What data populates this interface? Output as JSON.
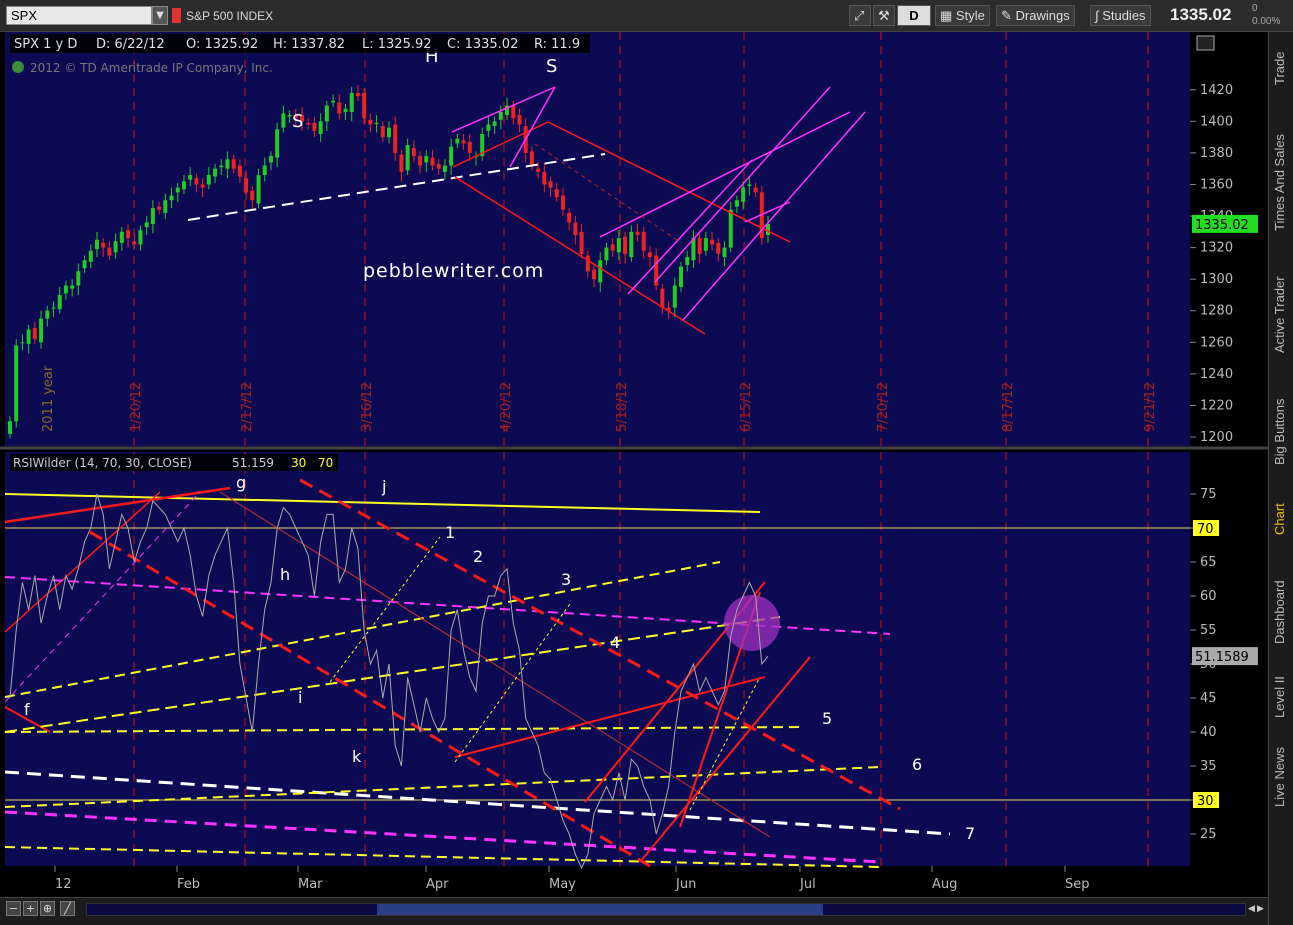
{
  "toolbar": {
    "symbol": "SPX",
    "description": "S&P 500 INDEX",
    "period_button": "D",
    "style_label": "Style",
    "drawings_label": "Drawings",
    "studies_label": "Studies",
    "last_price": "1335.02",
    "change_top": "0",
    "change_bottom": "0.00%"
  },
  "price_header": {
    "symbol_period": "SPX 1 y D",
    "date": "D: 6/22/12",
    "open": "O: 1325.92",
    "high": "H: 1337.82",
    "low": "L: 1325.92",
    "close": "C: 1335.02",
    "range": "R: 11.9",
    "copyright": "2012 © TD Ameritrade IP Company, Inc."
  },
  "rsi_header": {
    "study": "RSIWilder (14, 70, 30, CLOSE)",
    "value": "51.159",
    "ob": "30",
    "os": "70"
  },
  "sidebar": {
    "tabs": [
      "Trade",
      "Times And Sales",
      "Active Trader",
      "Big Buttons",
      "Chart",
      "Dashboard",
      "Level II",
      "Live News"
    ],
    "active": "Chart"
  },
  "colors": {
    "background": "#0c0a52",
    "grid_red": "#cc1010",
    "up": "#22cc22",
    "down": "#ee2222",
    "red_line": "#ff1a1a",
    "magenta": "#ff33ff",
    "yellow": "#ffff22",
    "white": "#ffffff"
  },
  "chart_data": [
    {
      "type": "candlestick",
      "title": "SPX 1 y D",
      "ylim": [
        1200,
        1430
      ],
      "y_ticks": [
        1200,
        1220,
        1240,
        1260,
        1280,
        1300,
        1320,
        1340,
        1360,
        1380,
        1400,
        1420
      ],
      "last_value_label": "1335.02",
      "watermark": "pebblewriter.com",
      "period_label": "2011 year",
      "date_markers": [
        "1/20/12",
        "2/17/12",
        "3/16/12",
        "4/20/12",
        "5/18/12",
        "6/15/12",
        "7/20/12",
        "8/17/12",
        "9/21/12"
      ],
      "annotations": [
        "S",
        "H",
        "S"
      ],
      "close_series": [
        1210,
        1258,
        1260,
        1268,
        1262,
        1275,
        1280,
        1282,
        1290,
        1296,
        1296,
        1305,
        1312,
        1318,
        1325,
        1320,
        1315,
        1324,
        1330,
        1326,
        1322,
        1331,
        1336,
        1345,
        1344,
        1350,
        1353,
        1358,
        1362,
        1366,
        1360,
        1358,
        1366,
        1370,
        1372,
        1376,
        1370,
        1365,
        1355,
        1350,
        1366,
        1372,
        1378,
        1395,
        1405,
        1404,
        1402,
        1400,
        1398,
        1394,
        1400,
        1410,
        1413,
        1405,
        1408,
        1418,
        1416,
        1402,
        1398,
        1399,
        1390,
        1396,
        1380,
        1368,
        1385,
        1378,
        1372,
        1378,
        1372,
        1370,
        1372,
        1384,
        1389,
        1386,
        1380,
        1378,
        1392,
        1398,
        1400,
        1406,
        1410,
        1402,
        1398,
        1380,
        1372,
        1368,
        1360,
        1358,
        1352,
        1344,
        1336,
        1328,
        1316,
        1305,
        1300,
        1312,
        1320,
        1318,
        1326,
        1316,
        1330,
        1328,
        1318,
        1314,
        1296,
        1282,
        1280,
        1296,
        1308,
        1314,
        1326,
        1316,
        1326,
        1322,
        1316,
        1320,
        1344,
        1350,
        1358,
        1360,
        1355,
        1326,
        1335
      ]
    },
    {
      "type": "line",
      "title": "RSIWilder (14, 70, 30, CLOSE)",
      "ylim": [
        20,
        80
      ],
      "y_ticks": [
        25,
        30,
        35,
        40,
        45,
        50,
        55,
        60,
        65,
        70,
        75
      ],
      "levels": [
        70,
        30
      ],
      "last_value_label": "51.1589",
      "x_tick_labels": [
        "12",
        "Feb",
        "Mar",
        "Apr",
        "May",
        "Jun",
        "Jul",
        "Aug",
        "Sep"
      ],
      "annotations": [
        "g",
        "j",
        "1",
        "2",
        "3",
        "h",
        "4",
        "i",
        "f",
        "5",
        "k",
        "6",
        "7"
      ],
      "values": [
        45,
        55,
        62,
        58,
        63,
        56,
        60,
        63,
        58,
        63,
        61,
        64,
        68,
        70,
        75,
        72,
        64,
        68,
        72,
        70,
        65,
        68,
        70,
        74,
        73,
        72,
        70,
        68,
        70,
        66,
        60,
        57,
        63,
        66,
        68,
        70,
        62,
        50,
        45,
        40,
        50,
        58,
        62,
        70,
        73,
        72,
        70,
        68,
        66,
        60,
        68,
        72,
        72,
        62,
        64,
        70,
        67,
        55,
        50,
        52,
        45,
        50,
        38,
        35,
        48,
        44,
        40,
        45,
        42,
        40,
        42,
        55,
        58,
        52,
        48,
        46,
        56,
        60,
        60,
        63,
        64,
        56,
        52,
        42,
        40,
        38,
        34,
        33,
        30,
        27,
        25,
        22,
        20,
        22,
        28,
        30,
        32,
        30,
        34,
        30,
        36,
        35,
        32,
        30,
        25,
        28,
        32,
        40,
        46,
        48,
        50,
        46,
        48,
        46,
        44,
        46,
        54,
        58,
        60,
        62,
        60,
        50,
        51.16
      ]
    }
  ]
}
